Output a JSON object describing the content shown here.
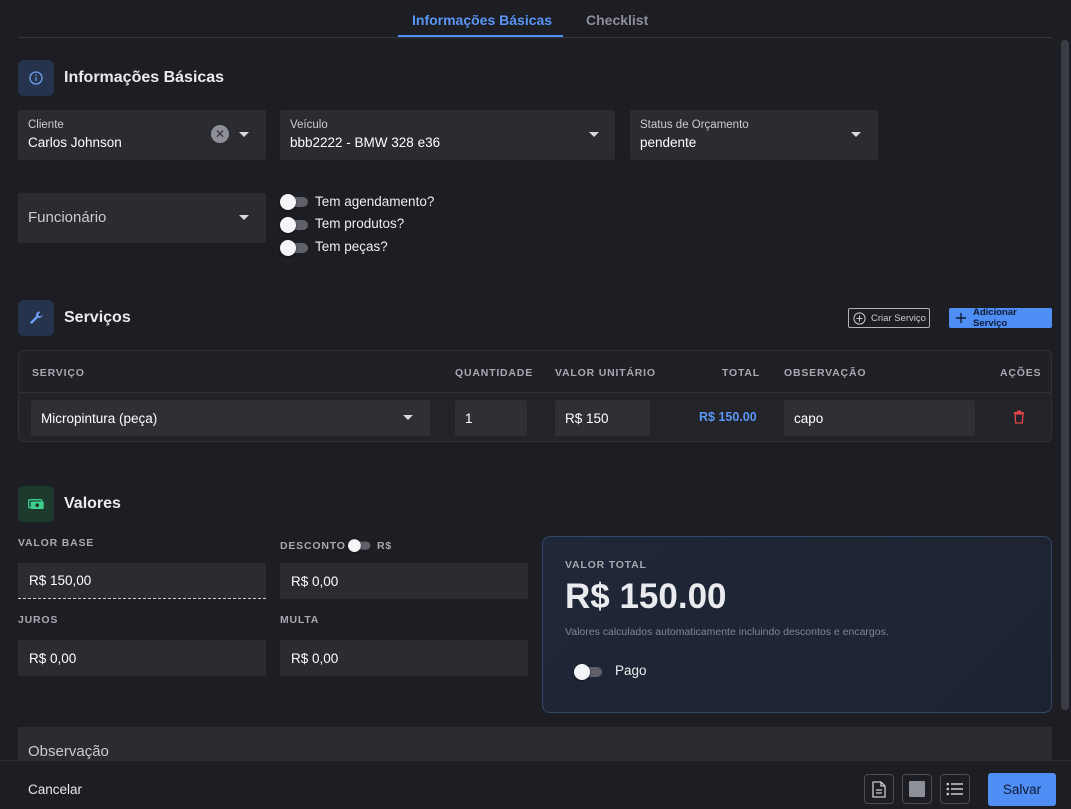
{
  "tabs": [
    {
      "label": "Informações Básicas",
      "active": true
    },
    {
      "label": "Checklist",
      "active": false
    }
  ],
  "basic_info": {
    "title": "Informações Básicas",
    "icon": "info-circle-icon",
    "cliente": {
      "label": "Cliente",
      "value": "Carlos Johnson"
    },
    "veiculo": {
      "label": "Veículo",
      "value": "bbb2222 - BMW 328 e36"
    },
    "status": {
      "label": "Status de Orçamento",
      "value": "pendente"
    },
    "funcionario": {
      "placeholder": "Funcionário"
    },
    "toggles": [
      {
        "label": "Tem agendamento?",
        "on": false
      },
      {
        "label": "Tem produtos?",
        "on": false
      },
      {
        "label": "Tem peças?",
        "on": false
      }
    ]
  },
  "services": {
    "title": "Serviços",
    "icon": "wrench-icon",
    "create_label": "Criar Serviço",
    "add_label": "Adicionar Serviço",
    "columns": [
      "SERVIÇO",
      "QUANTIDADE",
      "VALOR UNITÁRIO",
      "TOTAL",
      "OBSERVAÇÃO",
      "AÇÕES"
    ],
    "rows": [
      {
        "servico": "Micropintura (peça)",
        "quantidade": "1",
        "valor_unitario": "R$ 150",
        "total": "R$ 150.00",
        "observacao": "capo"
      }
    ]
  },
  "values": {
    "title": "Valores",
    "icon": "money-icon",
    "valor_base": {
      "label": "VALOR BASE",
      "value": "R$ 150,00"
    },
    "desconto": {
      "label": "DESCONTO",
      "toggle_label": "R$",
      "value": "R$ 0,00"
    },
    "juros": {
      "label": "JUROS",
      "value": "R$ 0,00"
    },
    "multa": {
      "label": "MULTA",
      "value": "R$ 0,00"
    },
    "total_panel": {
      "label": "VALOR TOTAL",
      "amount": "R$ 150.00",
      "note": "Valores calculados automaticamente incluindo descontos e encargos.",
      "paid_label": "Pago"
    }
  },
  "observacao": {
    "label": "Observação"
  },
  "footer": {
    "cancel_label": "Cancelar",
    "save_label": "Salvar",
    "icons": [
      "document-icon",
      "square-icon",
      "list-icon"
    ]
  },
  "colors": {
    "background": "#1c1e23",
    "field": "#2a2c31",
    "accent": "#4f8ef5",
    "danger": "#e0464c"
  }
}
